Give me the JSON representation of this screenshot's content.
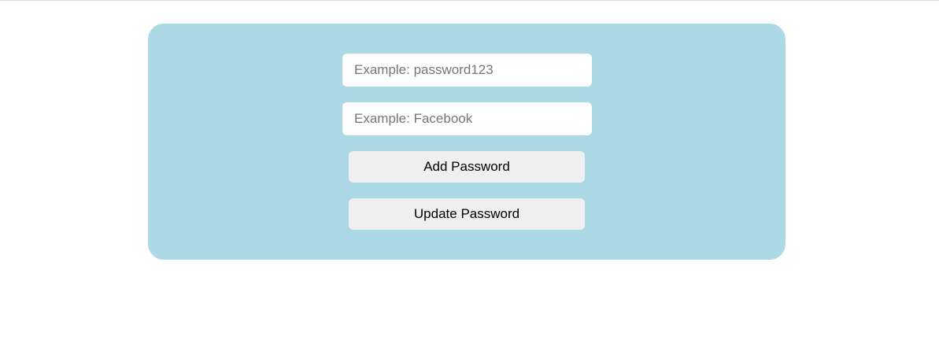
{
  "theme": {
    "panel_color": "#add8e6",
    "button_color": "#efefef"
  },
  "form": {
    "password_input": {
      "value": "",
      "placeholder": "Example: password123"
    },
    "site_input": {
      "value": "",
      "placeholder": "Example: Facebook"
    },
    "add_button_label": "Add Password",
    "update_button_label": "Update Password"
  }
}
